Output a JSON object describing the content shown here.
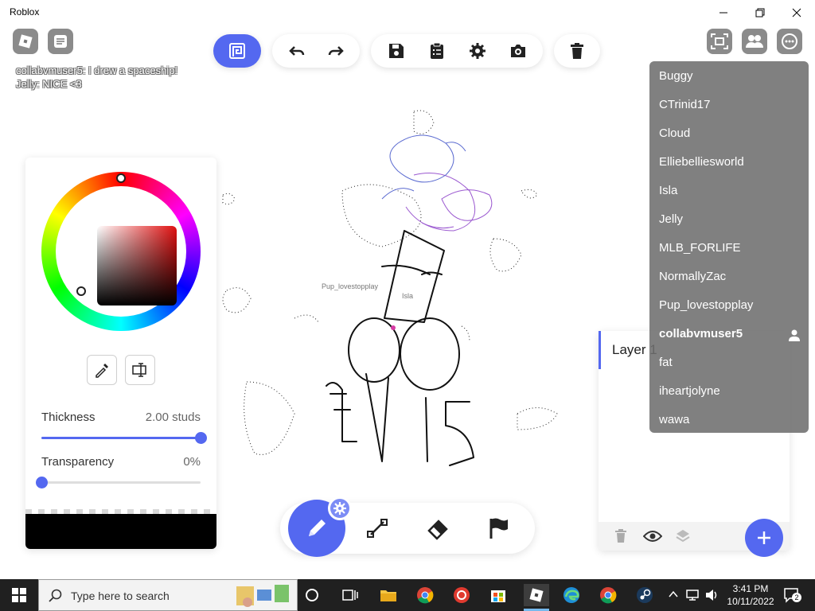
{
  "window": {
    "title": "Roblox",
    "controls": [
      "minimize",
      "restore",
      "close"
    ]
  },
  "chat": {
    "messages": [
      {
        "text": "collabvmuser5: I drew a spaceship!"
      },
      {
        "text": "Jelly: NICE <3"
      }
    ]
  },
  "toolbar": {
    "icons": [
      "frame-icon",
      "undo-icon",
      "redo-icon",
      "save-icon",
      "clipboard-icon",
      "settings-icon",
      "camera-icon",
      "trash-icon"
    ]
  },
  "color_panel": {
    "thickness_label": "Thickness",
    "thickness_value": "2.00 studs",
    "thickness_fraction": 1.0,
    "transparency_label": "Transparency",
    "transparency_value": "0%",
    "transparency_fraction": 0.0,
    "current_color": "#000000",
    "hue_color": "#e01010"
  },
  "canvas": {
    "name_tags": [
      "Pup_lovestopplay",
      "Isla"
    ]
  },
  "layers": {
    "items": [
      {
        "name": "Layer 1"
      }
    ]
  },
  "players": {
    "list": [
      {
        "name": "Buggy",
        "is_me": false
      },
      {
        "name": "CTrinid17",
        "is_me": false
      },
      {
        "name": "Cloud",
        "is_me": false
      },
      {
        "name": "Elliebelliesworld",
        "is_me": false
      },
      {
        "name": "Isla",
        "is_me": false
      },
      {
        "name": "Jelly",
        "is_me": false
      },
      {
        "name": "MLB_FORLIFE",
        "is_me": false
      },
      {
        "name": "NormallyZac",
        "is_me": false
      },
      {
        "name": "Pup_lovestopplay",
        "is_me": false
      },
      {
        "name": "collabvmuser5",
        "is_me": true
      },
      {
        "name": "fat",
        "is_me": false
      },
      {
        "name": "iheartjolyne",
        "is_me": false
      },
      {
        "name": "wawa",
        "is_me": false
      }
    ]
  },
  "taskbar": {
    "search_placeholder": "Type here to search",
    "time": "3:41 PM",
    "date": "10/11/2022",
    "notification_count": "2"
  },
  "colors": {
    "accent": "#5468f0",
    "taskbar": "#202020"
  }
}
